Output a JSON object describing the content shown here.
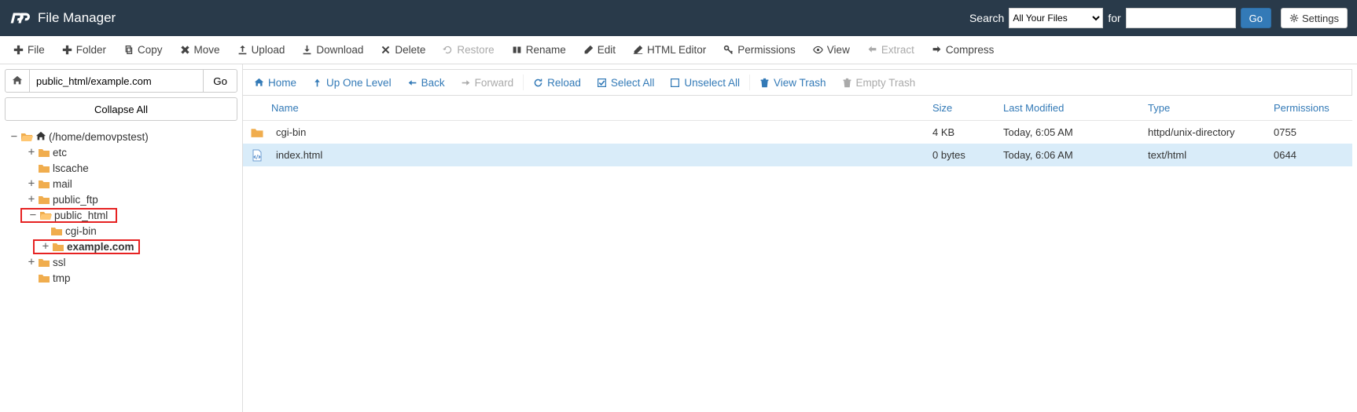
{
  "header": {
    "title": "File Manager",
    "search_label": "Search",
    "search_select": "All Your Files",
    "for_label": "for",
    "search_value": "",
    "go": "Go",
    "settings": "Settings"
  },
  "toolbar": {
    "file": "File",
    "folder": "Folder",
    "copy": "Copy",
    "move": "Move",
    "upload": "Upload",
    "download": "Download",
    "delete": "Delete",
    "restore": "Restore",
    "rename": "Rename",
    "edit": "Edit",
    "html_editor": "HTML Editor",
    "permissions": "Permissions",
    "view": "View",
    "extract": "Extract",
    "compress": "Compress"
  },
  "left": {
    "path_value": "public_html/example.com",
    "go": "Go",
    "collapse": "Collapse All",
    "root_label": "(/home/demovpstest)",
    "tree": {
      "etc": "etc",
      "lscache": "lscache",
      "mail": "mail",
      "public_ftp": "public_ftp",
      "public_html": "public_html",
      "cgi_bin": "cgi-bin",
      "example": "example.com",
      "ssl": "ssl",
      "tmp": "tmp"
    }
  },
  "actions": {
    "home": "Home",
    "up": "Up One Level",
    "back": "Back",
    "forward": "Forward",
    "reload": "Reload",
    "select_all": "Select All",
    "unselect_all": "Unselect All",
    "view_trash": "View Trash",
    "empty_trash": "Empty Trash"
  },
  "grid": {
    "headers": {
      "name": "Name",
      "size": "Size",
      "mod": "Last Modified",
      "type": "Type",
      "perm": "Permissions"
    },
    "rows": [
      {
        "name": "cgi-bin",
        "size": "4 KB",
        "mod": "Today, 6:05 AM",
        "type": "httpd/unix-directory",
        "perm": "0755",
        "icon": "folder",
        "selected": false
      },
      {
        "name": "index.html",
        "size": "0 bytes",
        "mod": "Today, 6:06 AM",
        "type": "text/html",
        "perm": "0644",
        "icon": "html",
        "selected": true
      }
    ]
  }
}
